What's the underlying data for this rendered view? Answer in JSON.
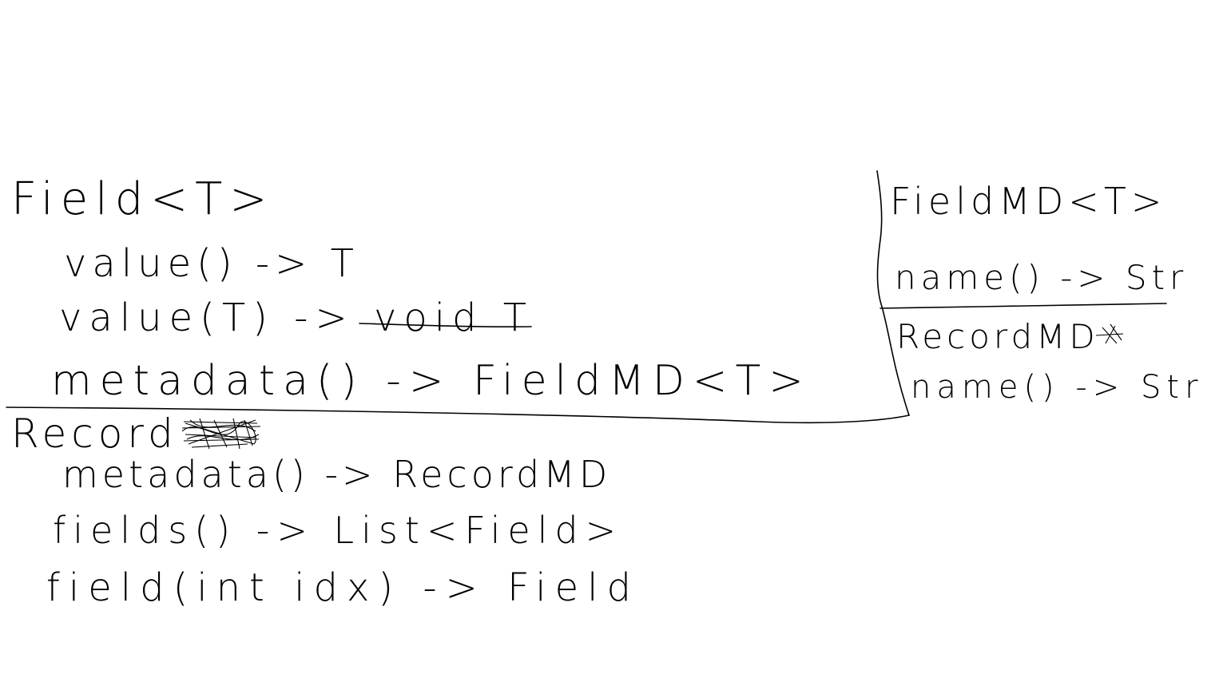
{
  "field_class": {
    "title": "Field<T>",
    "methods": [
      "value() -> T",
      "value(T) -> void T",
      "metadata() -> FieldMD<T>"
    ],
    "struck_text": "void"
  },
  "record_class": {
    "title": "Record",
    "methods": [
      "metadata() -> RecordMD",
      "fields() -> List<Field>",
      "field(int idx) -> Field"
    ]
  },
  "metadata_panel": {
    "field_md": {
      "title": "FieldMD<T>",
      "methods": [
        "name() -> Str"
      ]
    },
    "record_md": {
      "title": "RecordMD",
      "methods": [
        "name() -> Str"
      ]
    }
  }
}
